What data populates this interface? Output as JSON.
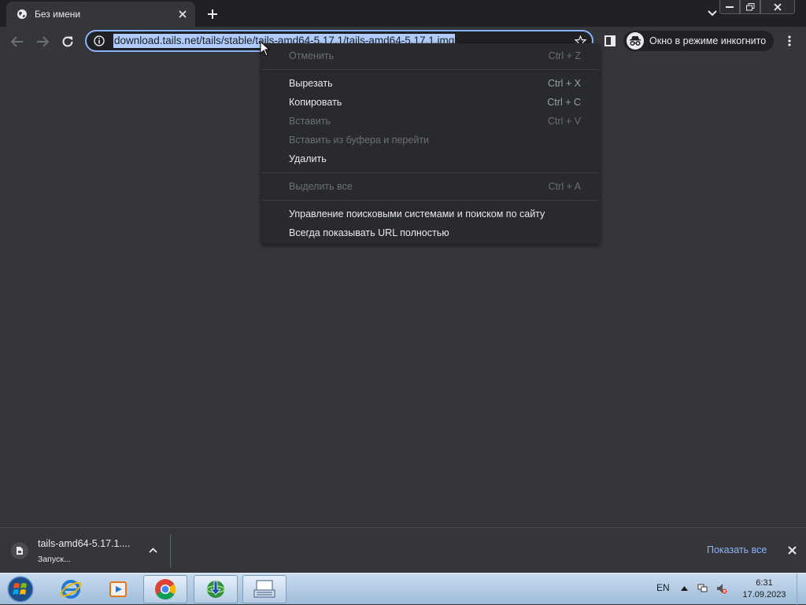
{
  "tab": {
    "title": "Без имени"
  },
  "toolbar": {
    "url": "download.tails.net/tails/stable/tails-amd64-5.17.1/tails-amd64-5.17.1.img",
    "incognito_label": "Окно в режиме инкогнито"
  },
  "context_menu": {
    "undo": {
      "label": "Отменить",
      "shortcut": "Ctrl + Z"
    },
    "cut": {
      "label": "Вырезать",
      "shortcut": "Ctrl + X"
    },
    "copy": {
      "label": "Копировать",
      "shortcut": "Ctrl + C"
    },
    "paste": {
      "label": "Вставить",
      "shortcut": "Ctrl + V"
    },
    "paste_go": {
      "label": "Вставить из буфера и перейти"
    },
    "delete": {
      "label": "Удалить"
    },
    "select_all": {
      "label": "Выделить все",
      "shortcut": "Ctrl + A"
    },
    "manage_search": {
      "label": "Управление поисковыми системами и поиском по сайту"
    },
    "show_full_url": {
      "label": "Всегда показывать URL полностью"
    }
  },
  "download_shelf": {
    "filename": "tails-amd64-5.17.1....",
    "status": "Запуск...",
    "show_all": "Показать все"
  },
  "taskbar": {
    "language": "EN",
    "time": "6:31",
    "date": "17.09.2023"
  },
  "colors": {
    "accent": "#8ab4f8",
    "selection": "#aecbfa",
    "background": "#35363a"
  }
}
